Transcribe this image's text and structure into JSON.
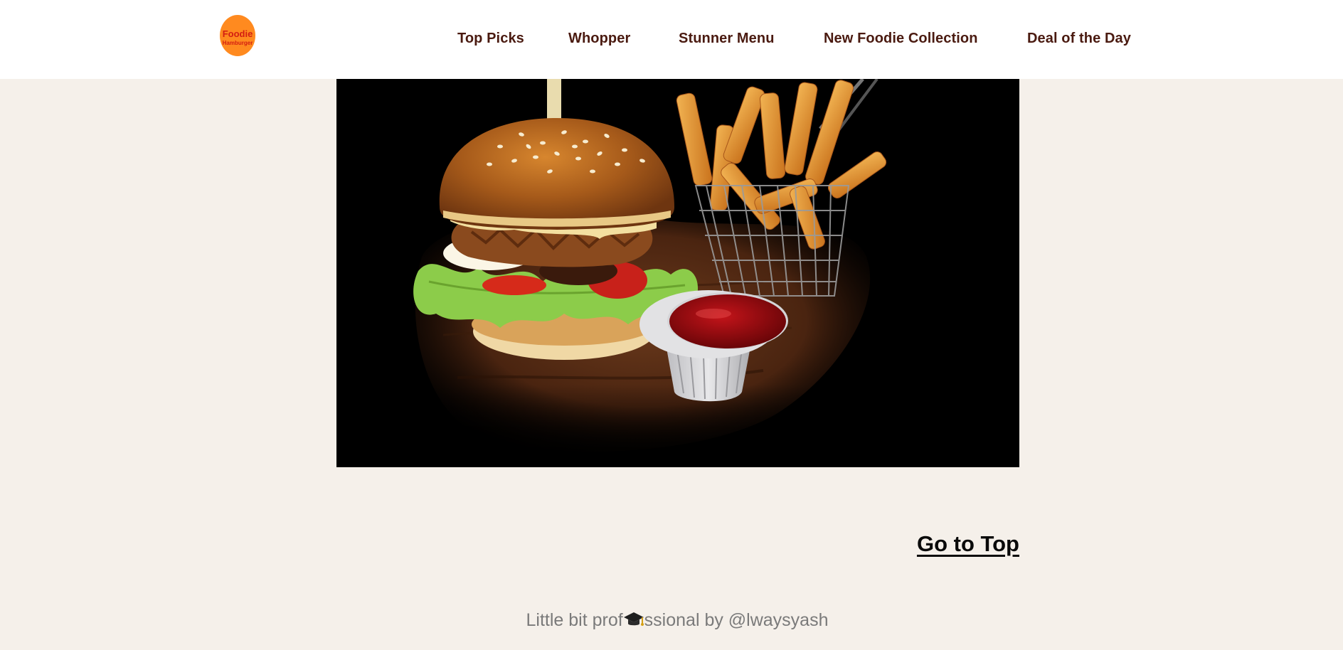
{
  "header": {
    "logo": {
      "line1": "Foodie",
      "line2": "Hamburger",
      "icon": "burger-logo",
      "bun_color": "#ff8a1f",
      "text_color": "#d31e12"
    },
    "nav": [
      {
        "label": "Top Picks"
      },
      {
        "label": "Whopper"
      },
      {
        "label": "Stunner Menu"
      },
      {
        "label": "New Foodie Collection"
      },
      {
        "label": "Deal of the Day"
      }
    ]
  },
  "hero": {
    "image": "burger-fries-ketchup-photo"
  },
  "go_to_top": "Go to Top",
  "footer": {
    "text_before": "Little bit prof",
    "icon": "graduation-cap-icon",
    "text_after": "ssional by @lwaysyash"
  },
  "colors": {
    "page_bg": "#f5f0ea",
    "header_bg": "#ffffff",
    "nav_text": "#4a1a10",
    "footer_text": "#7a7a7a"
  }
}
